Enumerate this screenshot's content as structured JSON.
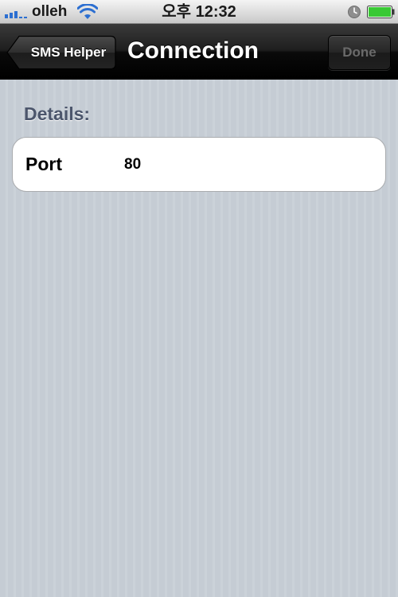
{
  "status_bar": {
    "carrier": "olleh",
    "time": "오후 12:32",
    "signal_icon": "signal-bars-icon",
    "wifi_icon": "wifi-icon",
    "alarm_icon": "alarm-clock-icon",
    "battery_icon": "battery-icon",
    "battery_level": 1.0,
    "battery_color": "#39c934"
  },
  "nav_bar": {
    "back_label": "SMS Helper",
    "title": "Connection",
    "done_label": "Done"
  },
  "details": {
    "header": "Details:",
    "rows": [
      {
        "label": "Port",
        "value": "80"
      }
    ]
  },
  "colors": {
    "background": "#c5ccd4",
    "section_header": "#4c566c",
    "navbar": "#1e1e1e",
    "done_disabled_text": "#6a6a6a"
  }
}
